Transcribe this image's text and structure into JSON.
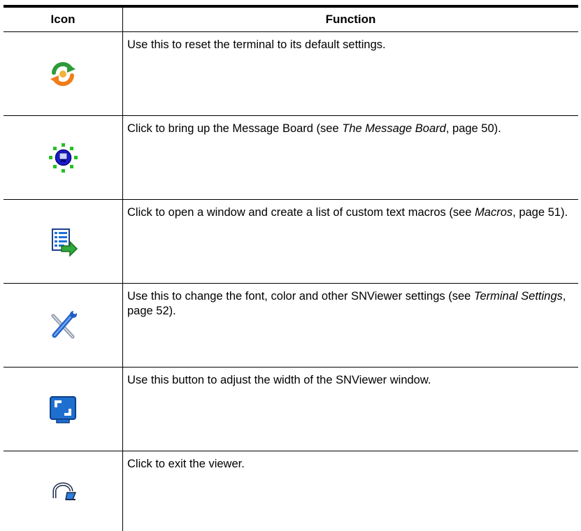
{
  "table": {
    "headers": {
      "icon": "Icon",
      "function": "Function"
    },
    "rows": [
      {
        "icon": "reset-icon",
        "pre": "Use this to reset the terminal to its default settings.",
        "ref": "",
        "post": ""
      },
      {
        "icon": "message-board-icon",
        "pre": "Click to bring up the Message Board (see ",
        "ref": "The Message Board",
        "post": ", page 50)."
      },
      {
        "icon": "macros-icon",
        "pre": "Click to open a window and create a list of custom text macros (see ",
        "ref": "Macros",
        "post": ", page 51)."
      },
      {
        "icon": "terminal-settings-icon",
        "pre": "Use this to change the font, color and other SNViewer settings (see ",
        "ref": "Terminal Settings",
        "post": ", page 52)."
      },
      {
        "icon": "adjust-width-icon",
        "pre": "Use this button to adjust the width of the SNViewer window.",
        "ref": "",
        "post": ""
      },
      {
        "icon": "exit-icon",
        "pre": "Click to exit the viewer.",
        "ref": "",
        "post": ""
      }
    ]
  }
}
